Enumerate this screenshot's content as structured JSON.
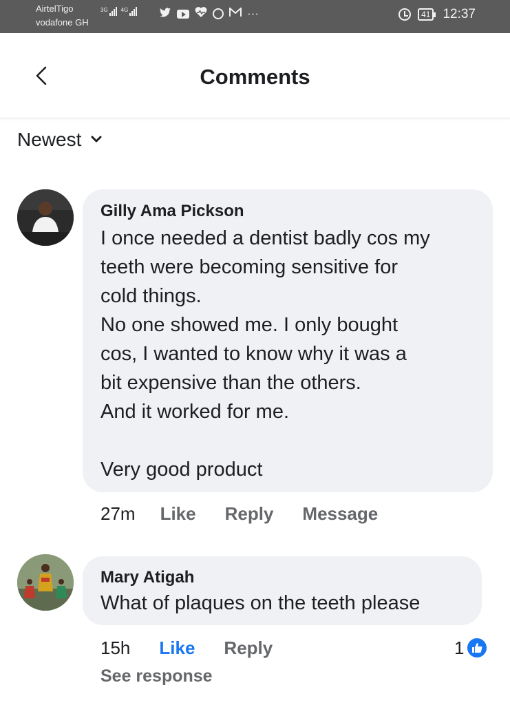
{
  "status_bar": {
    "carrier_1": "AirtelTigo",
    "carrier_2": "vodafone GH",
    "signal_1_label": "3G",
    "signal_2_label": "4G",
    "app_icons": [
      "twitter-icon",
      "youtube-icon",
      "heart-pulse-icon",
      "circle-icon",
      "gmail-icon",
      "more-icon"
    ],
    "more": "···",
    "battery": "41",
    "time": "12:37"
  },
  "header": {
    "title": "Comments"
  },
  "sort": {
    "label": "Newest"
  },
  "comments": [
    {
      "author": "Gilly Ama Pickson",
      "lines": [
        "I once needed a dentist badly cos my",
        "teeth were becoming sensitive for",
        "cold things.",
        "No one showed me. I only bought",
        "cos, I wanted to know why it was a",
        "bit expensive than the others.",
        "And it worked for me.",
        "",
        "Very good product"
      ],
      "time": "27m",
      "like": "Like",
      "reply": "Reply",
      "message": "Message"
    },
    {
      "author": "Mary Atigah",
      "lines": [
        "What of plaques on the teeth please"
      ],
      "time": "15h",
      "like": "Like",
      "reply": "Reply",
      "reaction_count": "1",
      "see_response": "See response"
    }
  ],
  "colors": {
    "status_bar": "#5b5b5b",
    "bubble": "#eff1f5",
    "secondary_text": "#65676b",
    "accent": "#1877f2"
  }
}
